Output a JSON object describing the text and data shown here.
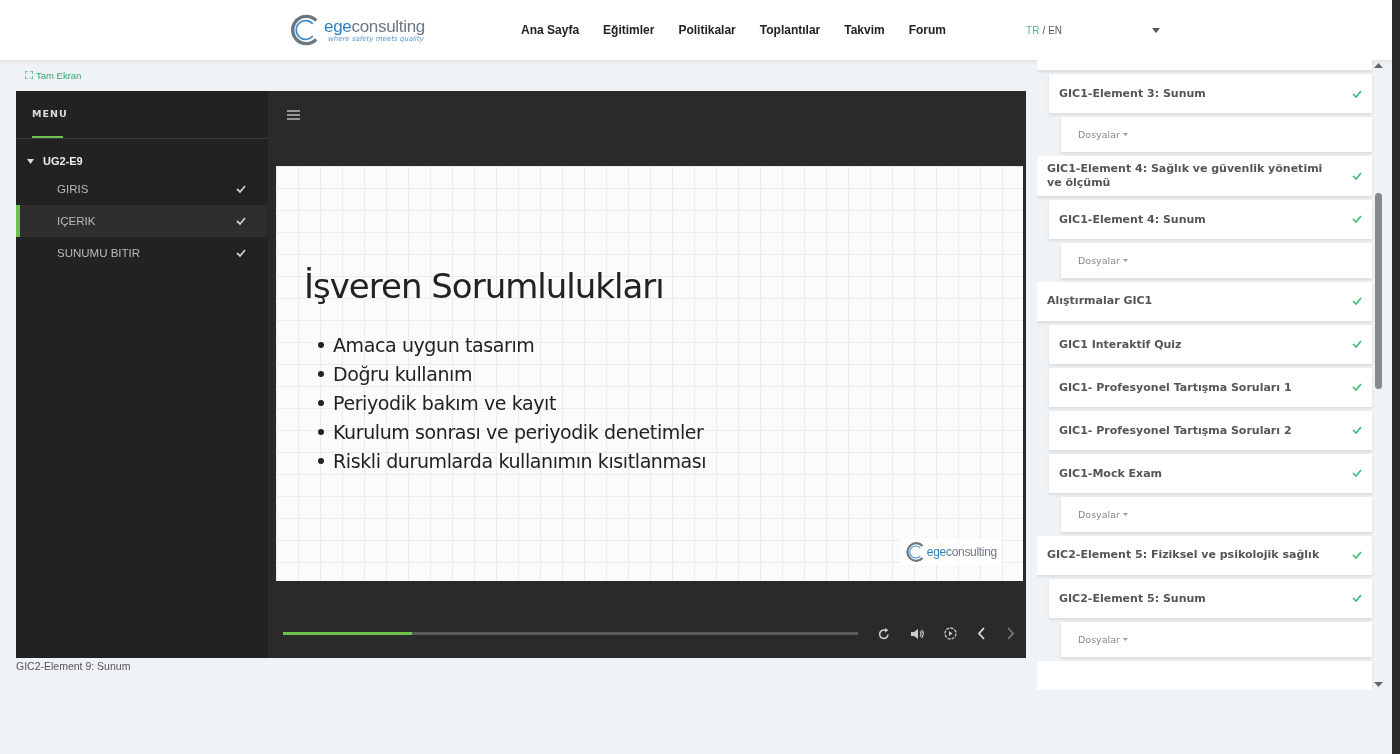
{
  "header": {
    "logo": {
      "prefix": "ege",
      "suffix": "consulting",
      "tagline": "where safety meets quality"
    },
    "nav": [
      {
        "label": "Ana Sayfa"
      },
      {
        "label": "Eğitimler"
      },
      {
        "label": "Politikalar"
      },
      {
        "label": "Toplantılar"
      },
      {
        "label": "Takvim"
      },
      {
        "label": "Forum"
      }
    ],
    "languages": [
      {
        "label": "TR",
        "selected": true
      },
      {
        "label": "EN",
        "selected": false
      }
    ],
    "language_separator": "/"
  },
  "fullscreen_link": "Tam Ekran",
  "player": {
    "menu_tab": {
      "label": "MENU",
      "selected": true
    },
    "tree": [
      {
        "label": "UG2-E9",
        "expanded": true,
        "children": [
          {
            "label": "GIRIS",
            "selected": false,
            "done": true
          },
          {
            "label": "IÇERIK",
            "selected": true,
            "done": true
          },
          {
            "label": "SUNUMU BITIR",
            "selected": false,
            "done": true
          }
        ]
      }
    ],
    "slide": {
      "title": "İşveren Sorumlulukları",
      "bullets": [
        "Amaca uygun tasarım",
        "Doğru kullanım",
        "Periyodik bakım ve kayıt",
        "Kurulum sonrası ve periyodik denetimler",
        "Riskli durumlarda kullanımın kısıtlanması"
      ],
      "logo": {
        "prefix": "ege",
        "suffix": "consulting"
      }
    },
    "progress": {
      "level": 0.224
    },
    "next_disabled": true
  },
  "caption": "GIC2-Element 9: Sunum",
  "outline": [
    {
      "kind": "lesson",
      "label": "GIC1-Element 3: Sunum",
      "done": true
    },
    {
      "kind": "files",
      "label": "Dosyalar"
    },
    {
      "kind": "section",
      "label": "GIC1-Element 4: Sağlık ve güvenlik yönetimi ve ölçümü",
      "done": true
    },
    {
      "kind": "lesson",
      "label": "GIC1-Element 4: Sunum",
      "done": true
    },
    {
      "kind": "files",
      "label": "Dosyalar"
    },
    {
      "kind": "section",
      "label": "Alıştırmalar GIC1",
      "done": true
    },
    {
      "kind": "lesson",
      "label": "GIC1 Interaktif Quiz",
      "done": true
    },
    {
      "kind": "lesson",
      "label": "GIC1- Profesyonel Tartışma Soruları 1",
      "done": true
    },
    {
      "kind": "lesson",
      "label": "GIC1- Profesyonel Tartışma Soruları 2",
      "done": true
    },
    {
      "kind": "lesson",
      "label": "GIC1-Mock Exam",
      "done": true
    },
    {
      "kind": "files",
      "label": "Dosyalar"
    },
    {
      "kind": "section",
      "label": "GIC2-Element 5: Fiziksel ve psikolojik sağlık",
      "done": true
    },
    {
      "kind": "lesson",
      "label": "GIC2-Element 5: Sunum",
      "done": true
    },
    {
      "kind": "files",
      "label": "Dosyalar"
    }
  ]
}
